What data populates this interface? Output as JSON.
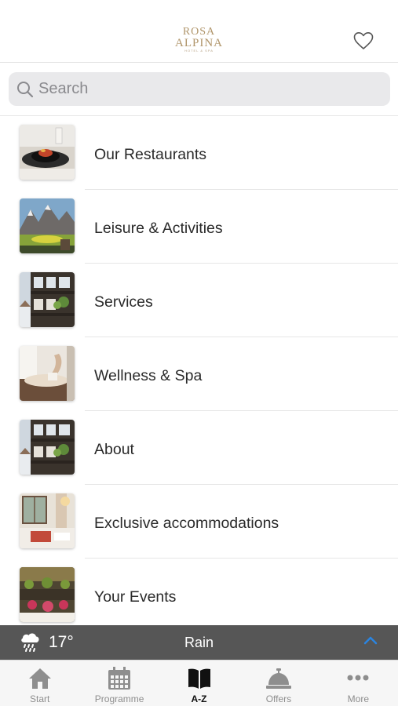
{
  "header": {
    "logo_line1": "ROSA",
    "logo_line2": "ALPINA",
    "logo_line3": "HOTEL & SPA",
    "brand_color": "#b0956a"
  },
  "search": {
    "placeholder": "Search"
  },
  "items": [
    {
      "label": "Our Restaurants",
      "icon": "restaurant-photo"
    },
    {
      "label": "Leisure & Activities",
      "icon": "mountain-photo"
    },
    {
      "label": "Services",
      "icon": "hotel-facade-photo"
    },
    {
      "label": "Wellness & Spa",
      "icon": "spa-photo"
    },
    {
      "label": "About",
      "icon": "hotel-facade-photo"
    },
    {
      "label": "Exclusive accommodations",
      "icon": "room-photo"
    },
    {
      "label": "Your Events",
      "icon": "event-photo"
    }
  ],
  "weather": {
    "temperature": "17°",
    "condition": "Rain",
    "icon": "rain-cloud-icon",
    "accent": "#2a84e0"
  },
  "tabs": [
    {
      "label": "Start",
      "icon": "home-icon",
      "active": false
    },
    {
      "label": "Programme",
      "icon": "calendar-icon",
      "active": false
    },
    {
      "label": "A-Z",
      "icon": "book-icon",
      "active": true
    },
    {
      "label": "Offers",
      "icon": "service-bell-icon",
      "active": false
    },
    {
      "label": "More",
      "icon": "more-dots-icon",
      "active": false
    }
  ]
}
